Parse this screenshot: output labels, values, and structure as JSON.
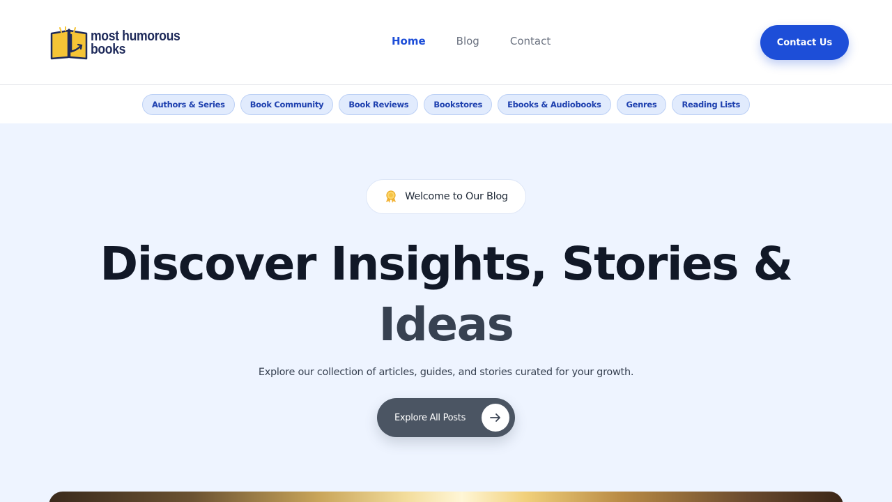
{
  "header": {
    "logo_line1": "most humorous",
    "logo_line2": "books",
    "logo_icon": "open-book-icon",
    "nav": [
      {
        "label": "Home",
        "active": true
      },
      {
        "label": "Blog",
        "active": false
      },
      {
        "label": "Contact",
        "active": false
      }
    ],
    "cta_label": "Contact Us"
  },
  "categories": [
    "Authors & Series",
    "Book Community",
    "Book Reviews",
    "Bookstores",
    "Ebooks & Audiobooks",
    "Genres",
    "Reading Lists"
  ],
  "hero": {
    "badge_text": "Welcome to Our Blog",
    "badge_icon": "award-ribbon-icon",
    "headline_line1": "Discover Insights, Stories &",
    "headline_line2": "Ideas",
    "subtitle": "Explore our collection of articles, guides, and stories curated for your growth.",
    "button_label": "Explore All Posts",
    "button_icon": "arrow-right-icon"
  },
  "colors": {
    "primary": "#1d4ed8",
    "hero_bg": "#eef4ff",
    "pill_bg": "#e1ebfd",
    "headline": "#111827",
    "explore_button": "#4b5563"
  }
}
